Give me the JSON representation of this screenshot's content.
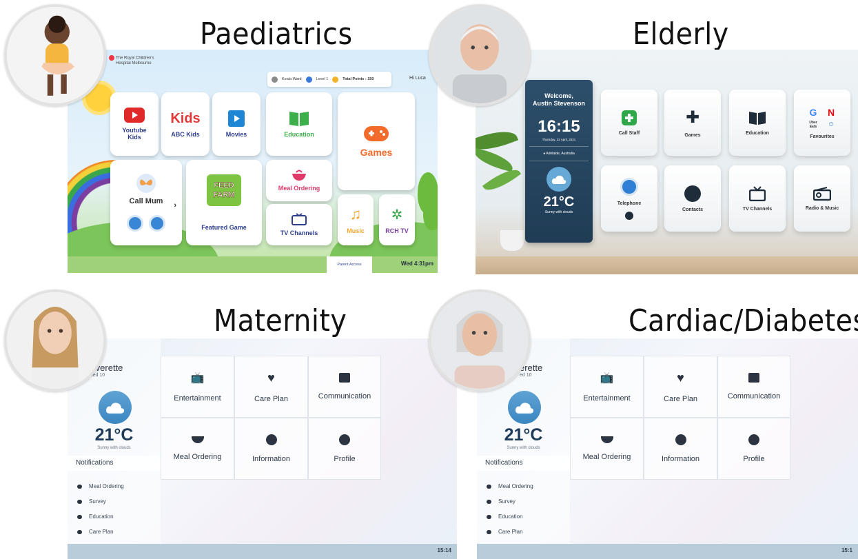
{
  "headings": {
    "paediatrics": "Paediatrics",
    "elderly": "Elderly",
    "maternity": "Maternity",
    "cardiac": "Cardiac/Diabetes"
  },
  "paediatrics": {
    "logo_line1": "The Royal Children's",
    "logo_line2": "Hospital Melbourne",
    "ward": "Koala Ward",
    "level": "Level 1",
    "points": "Total Points : 150",
    "greeting": "Hi Luca",
    "tiles": {
      "youtube": "Youtube Kids",
      "abc": "ABC Kids",
      "abc_logo": "Kids",
      "movies": "Movies",
      "education": "Education",
      "games": "Games",
      "call_mum": "Call Mum",
      "featured": "Featured Game",
      "featured_logo1": "FEED",
      "featured_logo2": "FARM",
      "meal": "Meal Ordering",
      "tv": "TV Channels",
      "music": "Music",
      "rch": "RCH TV"
    },
    "parent_access": "Parent Access",
    "datetime": "Wed 4:31pm"
  },
  "elderly": {
    "welcome": "Welcome,",
    "name": "Austin Stevenson",
    "clock": "16:15",
    "date": "Thursday, 22 April, 2021",
    "location": "Adelaide, Australia",
    "temp": "21°C",
    "condition": "Sunny with clouds",
    "tiles": {
      "call_staff": "Call Staff",
      "games": "Games",
      "education": "Education",
      "favourites": "Favourites",
      "uber": "Uber Eats",
      "telephone": "Telephone",
      "contacts": "Contacts",
      "tv": "TV Channels",
      "radio": "Radio & Music"
    }
  },
  "maternity": {
    "name": "Everette",
    "bed": "Bed 10",
    "temp": "21°C",
    "condition": "Sunny with clouds",
    "notifications": "Notifications",
    "notif_items": [
      "Meal Ordering",
      "Survey",
      "Education",
      "Care Plan"
    ],
    "cells": [
      "Entertainment",
      "Care Plan",
      "Communication",
      "Meal Ordering",
      "Information",
      "Profile"
    ],
    "time": "15:14"
  },
  "cardiac": {
    "name": "erette",
    "bed": "ed 10",
    "temp": "21°C",
    "condition": "Sunny with clouds",
    "notifications": "Notifications",
    "notif_items": [
      "Meal Ordering",
      "Survey",
      "Education",
      "Care Plan"
    ],
    "cells": [
      "Entertainment",
      "Care Plan",
      "Communication",
      "Meal Ordering",
      "Information",
      "Profile"
    ],
    "time": "15:1"
  },
  "colors": {
    "paed_text": "#2f3f8e",
    "games_orange": "#f26b2a",
    "elderly_panel": "#2d4f6b",
    "maternity_icon": "#2b3440"
  }
}
